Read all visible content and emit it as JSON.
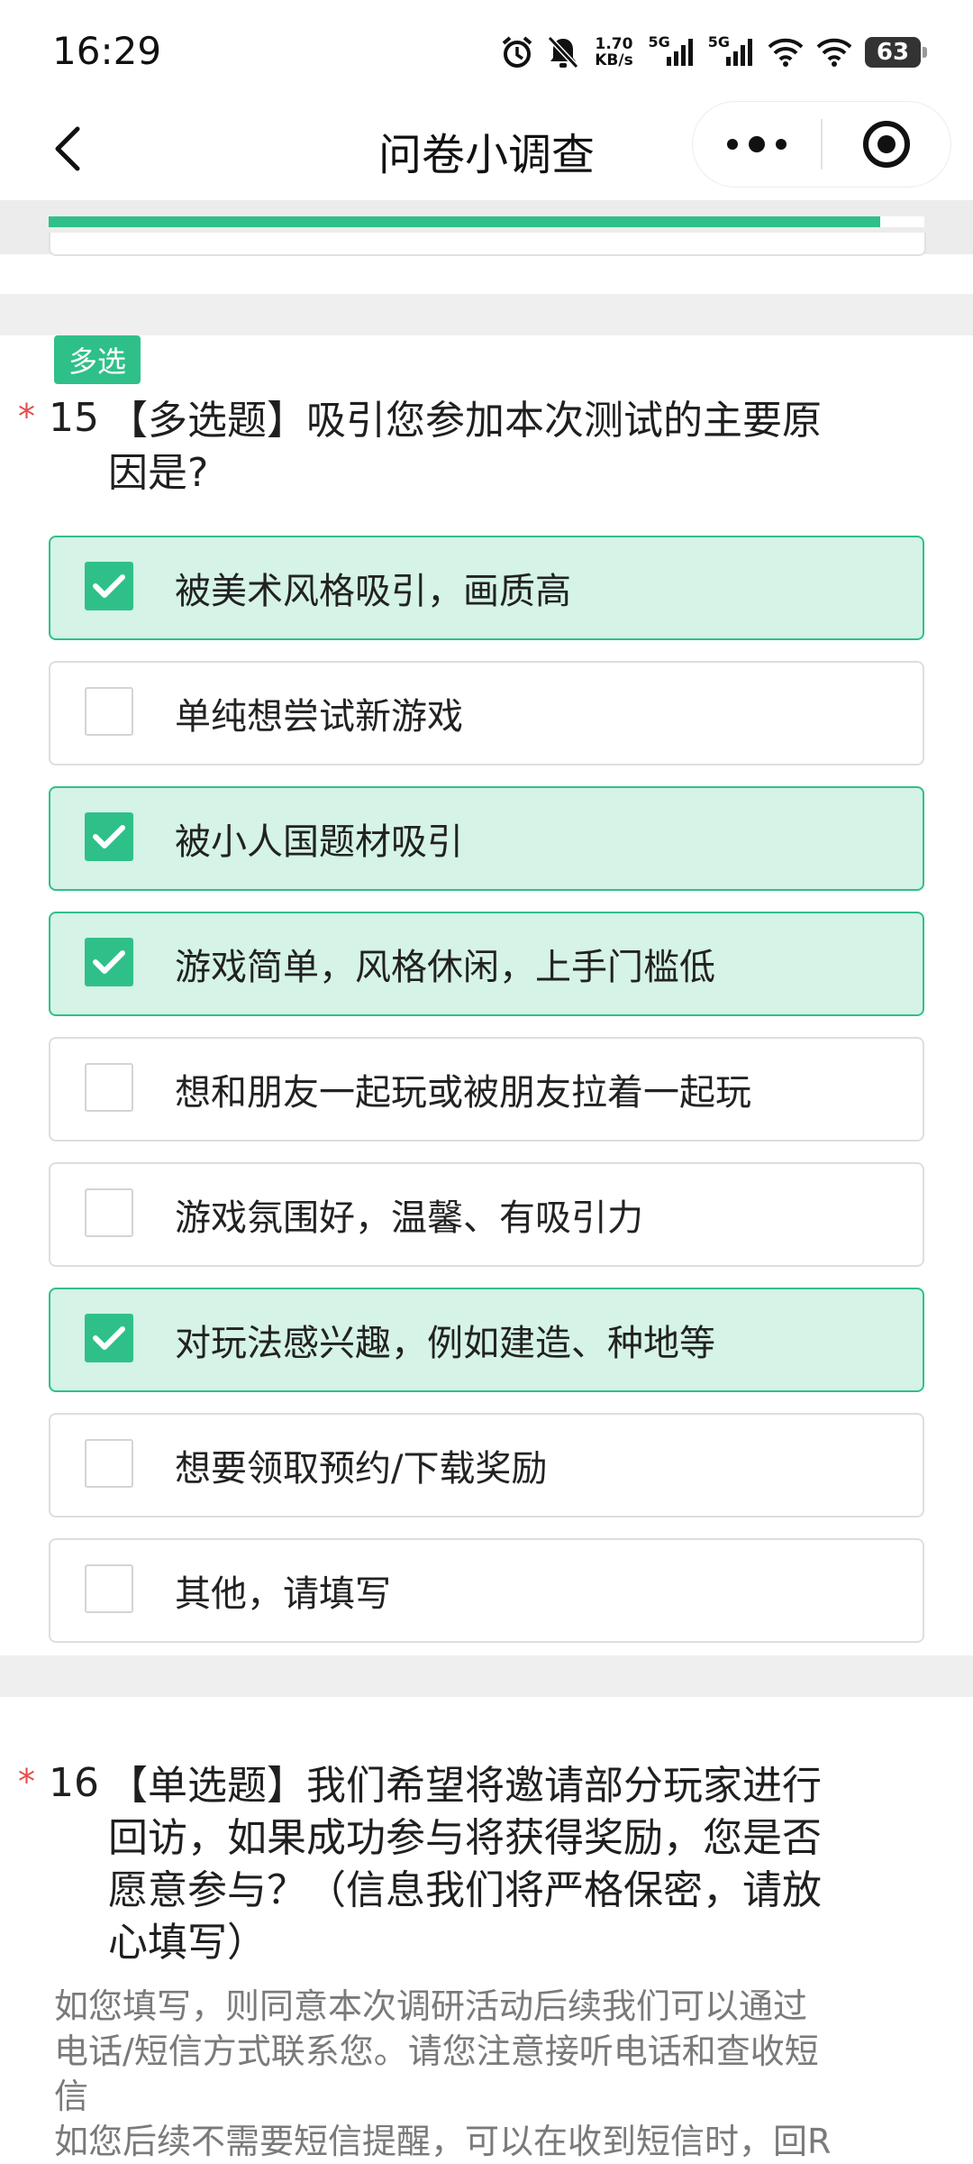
{
  "status_bar": {
    "time": "16:29",
    "net_speed_value": "1.70",
    "net_speed_unit": "KB/s",
    "signal_1": "5G",
    "signal_2": "5G",
    "battery": "63"
  },
  "nav": {
    "title": "问卷小调查"
  },
  "progress": {
    "fraction": 0.95
  },
  "question15": {
    "tag": "多选",
    "required_mark": "*",
    "number": "15",
    "title_line1": "【多选题】吸引您参加本次测试的主要原",
    "title_line2": "因是?",
    "options": [
      {
        "label": "被美术风格吸引，画质高",
        "checked": true
      },
      {
        "label": "单纯想尝试新游戏",
        "checked": false
      },
      {
        "label": "被小人国题材吸引",
        "checked": true
      },
      {
        "label": "游戏简单，风格休闲，上手门槛低",
        "checked": true
      },
      {
        "label": "想和朋友一起玩或被朋友拉着一起玩",
        "checked": false
      },
      {
        "label": "游戏氛围好，温馨、有吸引力",
        "checked": false
      },
      {
        "label": "对玩法感兴趣，例如建造、种地等",
        "checked": true
      },
      {
        "label": "想要领取预约/下载奖励",
        "checked": false
      },
      {
        "label": "其他，请填写",
        "checked": false
      }
    ]
  },
  "question16": {
    "required_mark": "*",
    "number": "16",
    "title_line1": "【单选题】我们希望将邀请部分玩家进行",
    "title_line2": "回访，如果成功参与将获得奖励，您是否",
    "title_line3": "愿意参与？（信息我们将严格保密，请放",
    "title_line4": "心填写）",
    "desc_line1": "如您填写，则同意本次调研活动后续我们可以通过",
    "desc_line2": "电话/短信方式联系您。请您注意接听电话和查收短",
    "desc_line3": "信",
    "desc_line4": "如您后续不需要短信提醒，可以在收到短信时，回R"
  },
  "colors": {
    "accent": "#2fc08a",
    "checked_bg": "#d5f3e6",
    "required": "#e34d4d"
  }
}
